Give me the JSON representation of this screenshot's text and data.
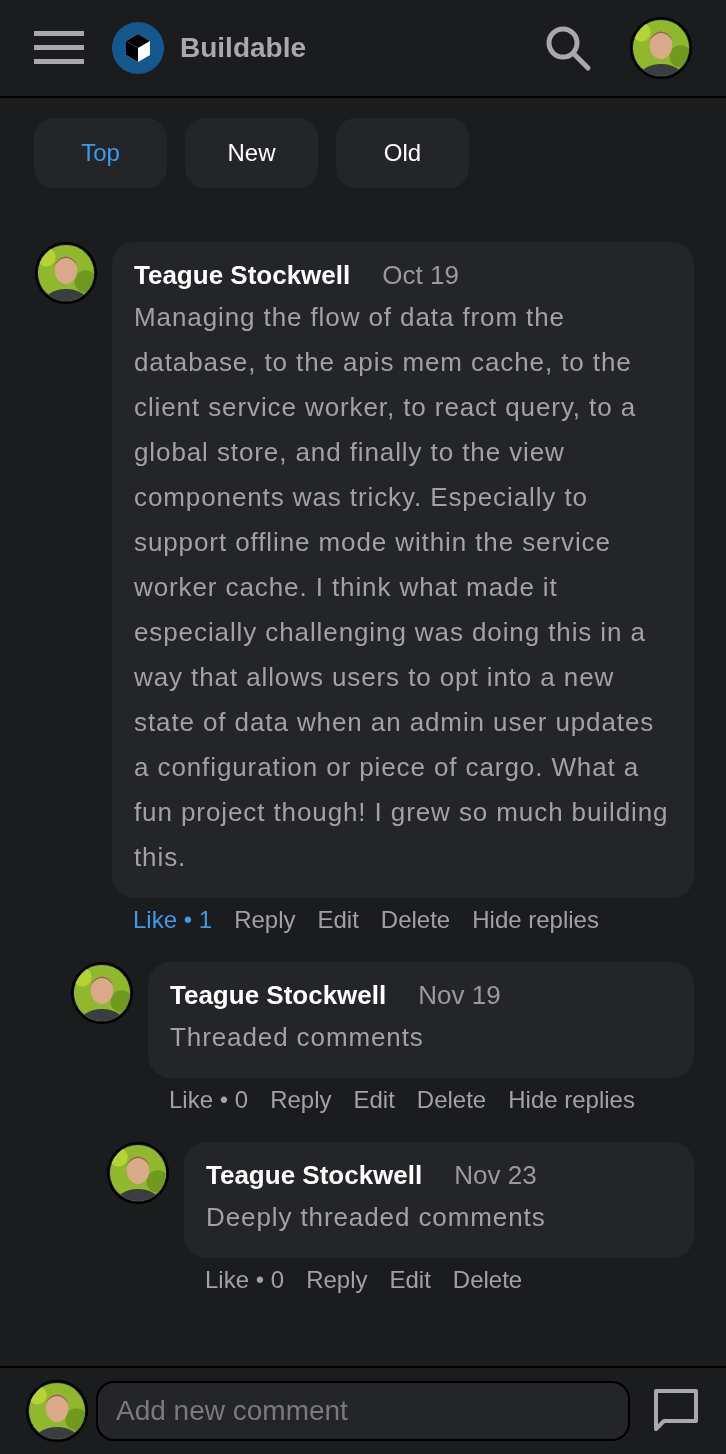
{
  "header": {
    "brand": "Buildable"
  },
  "sort_tabs": [
    {
      "label": "Top",
      "selected": true
    },
    {
      "label": "New",
      "selected": false
    },
    {
      "label": "Old",
      "selected": false
    }
  ],
  "comments": [
    {
      "author": "Teague Stockwell",
      "date": "Oct 19",
      "body": "Managing the flow of data from the database, to the apis mem cache, to the client service worker, to react query, to a global store, and finally to the view components was tricky. Especially to support offline mode within the service worker cache. I think what made it especially challenging was doing this in a way that allows users to opt into a new state of data when an admin user updates a configuration or piece of cargo. What a fun project though! I grew so much building this.",
      "like": {
        "label": "Like • 1",
        "liked": true
      },
      "actions": [
        "Reply",
        "Edit",
        "Delete",
        "Hide replies"
      ],
      "children": [
        {
          "author": "Teague Stockwell",
          "date": "Nov 19",
          "body": "Threaded comments",
          "like": {
            "label": "Like • 0",
            "liked": false
          },
          "actions": [
            "Reply",
            "Edit",
            "Delete",
            "Hide replies"
          ],
          "children": [
            {
              "author": "Teague Stockwell",
              "date": "Nov 23",
              "body": "Deeply threaded comments",
              "like": {
                "label": "Like • 0",
                "liked": false
              },
              "actions": [
                "Reply",
                "Edit",
                "Delete"
              ]
            }
          ]
        }
      ]
    }
  ],
  "composer": {
    "placeholder": "Add new comment"
  }
}
